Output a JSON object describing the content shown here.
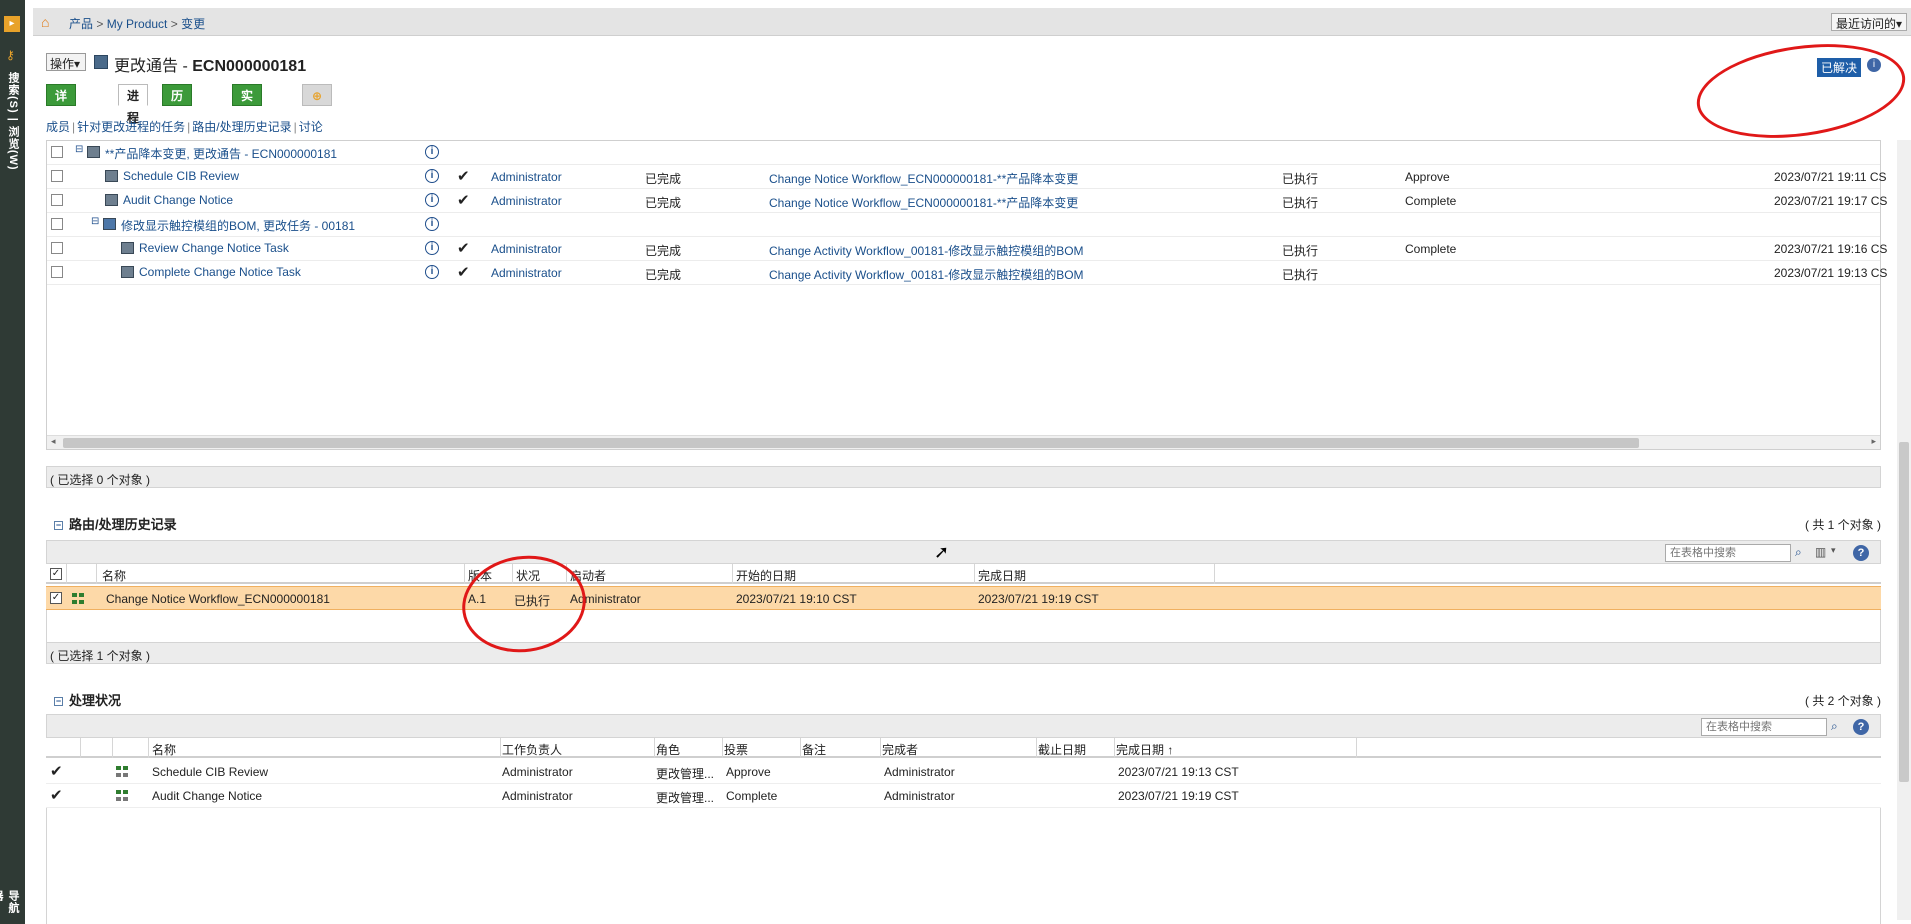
{
  "rail": {
    "vtext_top": "搜索(S) | 浏览(W)",
    "vtext_bottom": "导航器"
  },
  "breadcrumb": {
    "items": [
      "产品",
      "My Product",
      "变更"
    ],
    "sep": " > ",
    "recent": "最近访问的▾"
  },
  "header": {
    "ops_label": "操作▾",
    "title_prefix": "更改通告 - ",
    "title_id": "ECN000000181",
    "status": "已解决"
  },
  "tabs": [
    "详细信息",
    "进程",
    "历史记录",
    "实施计划"
  ],
  "subnav": [
    "成员",
    "针对更改进程的任务",
    "路由/处理历史记录",
    "讨论"
  ],
  "tree": {
    "root": "**产品降本变更, 更改通告 - ECN000000181",
    "rows": [
      {
        "name": "Schedule CIB Review",
        "user": "Administrator",
        "state": "已完成",
        "workflow": "Change Notice Workflow_ECN000000181-**产品降本变更",
        "exec": "已执行",
        "vote": "Approve",
        "date": "2023/07/21 19:11 CS"
      },
      {
        "name": "Audit Change Notice",
        "user": "Administrator",
        "state": "已完成",
        "workflow": "Change Notice Workflow_ECN000000181-**产品降本变更",
        "exec": "已执行",
        "vote": "Complete",
        "date": "2023/07/21 19:17 CS"
      }
    ],
    "sub_root": "修改显示触控模组的BOM, 更改任务 - 00181",
    "sub_rows": [
      {
        "name": "Review Change Notice Task",
        "user": "Administrator",
        "state": "已完成",
        "workflow": "Change Activity Workflow_00181-修改显示触控模组的BOM",
        "exec": "已执行",
        "vote": "Complete",
        "date": "2023/07/21 19:16 CS"
      },
      {
        "name": "Complete Change Notice Task",
        "user": "Administrator",
        "state": "已完成",
        "workflow": "Change Activity Workflow_00181-修改显示触控模组的BOM",
        "exec": "已执行",
        "vote": "",
        "date": "2023/07/21 19:13 CS"
      }
    ],
    "selection": "( 已选择 0 个对象 )"
  },
  "routing": {
    "title": "路由/处理历史记录",
    "count": "( 共 1 个对象 )",
    "search_placeholder": "在表格中搜索",
    "headers": [
      "名称",
      "版本",
      "状况",
      "启动者",
      "开始的日期",
      "完成日期"
    ],
    "rows": [
      {
        "name": "Change Notice Workflow_ECN000000181",
        "version": "A.1",
        "status": "已执行",
        "starter": "Administrator",
        "start": "2023/07/21 19:10 CST",
        "end": "2023/07/21 19:19 CST"
      }
    ],
    "selection": "( 已选择 1 个对象 )"
  },
  "processing": {
    "title": "处理状况",
    "count": "( 共 2 个对象 )",
    "search_placeholder": "在表格中搜索",
    "headers": [
      "名称",
      "工作负责人",
      "角色",
      "投票",
      "备注",
      "完成者",
      "截止日期",
      "完成日期 ↑"
    ],
    "rows": [
      {
        "name": "Schedule CIB Review",
        "owner": "Administrator",
        "role": "更改管理...",
        "vote": "Approve",
        "note": "",
        "completer": "Administrator",
        "due": "",
        "done": "2023/07/21 19:13 CST"
      },
      {
        "name": "Audit Change Notice",
        "owner": "Administrator",
        "role": "更改管理...",
        "vote": "Complete",
        "note": "",
        "completer": "Administrator",
        "due": "",
        "done": "2023/07/21 19:19 CST"
      }
    ]
  }
}
